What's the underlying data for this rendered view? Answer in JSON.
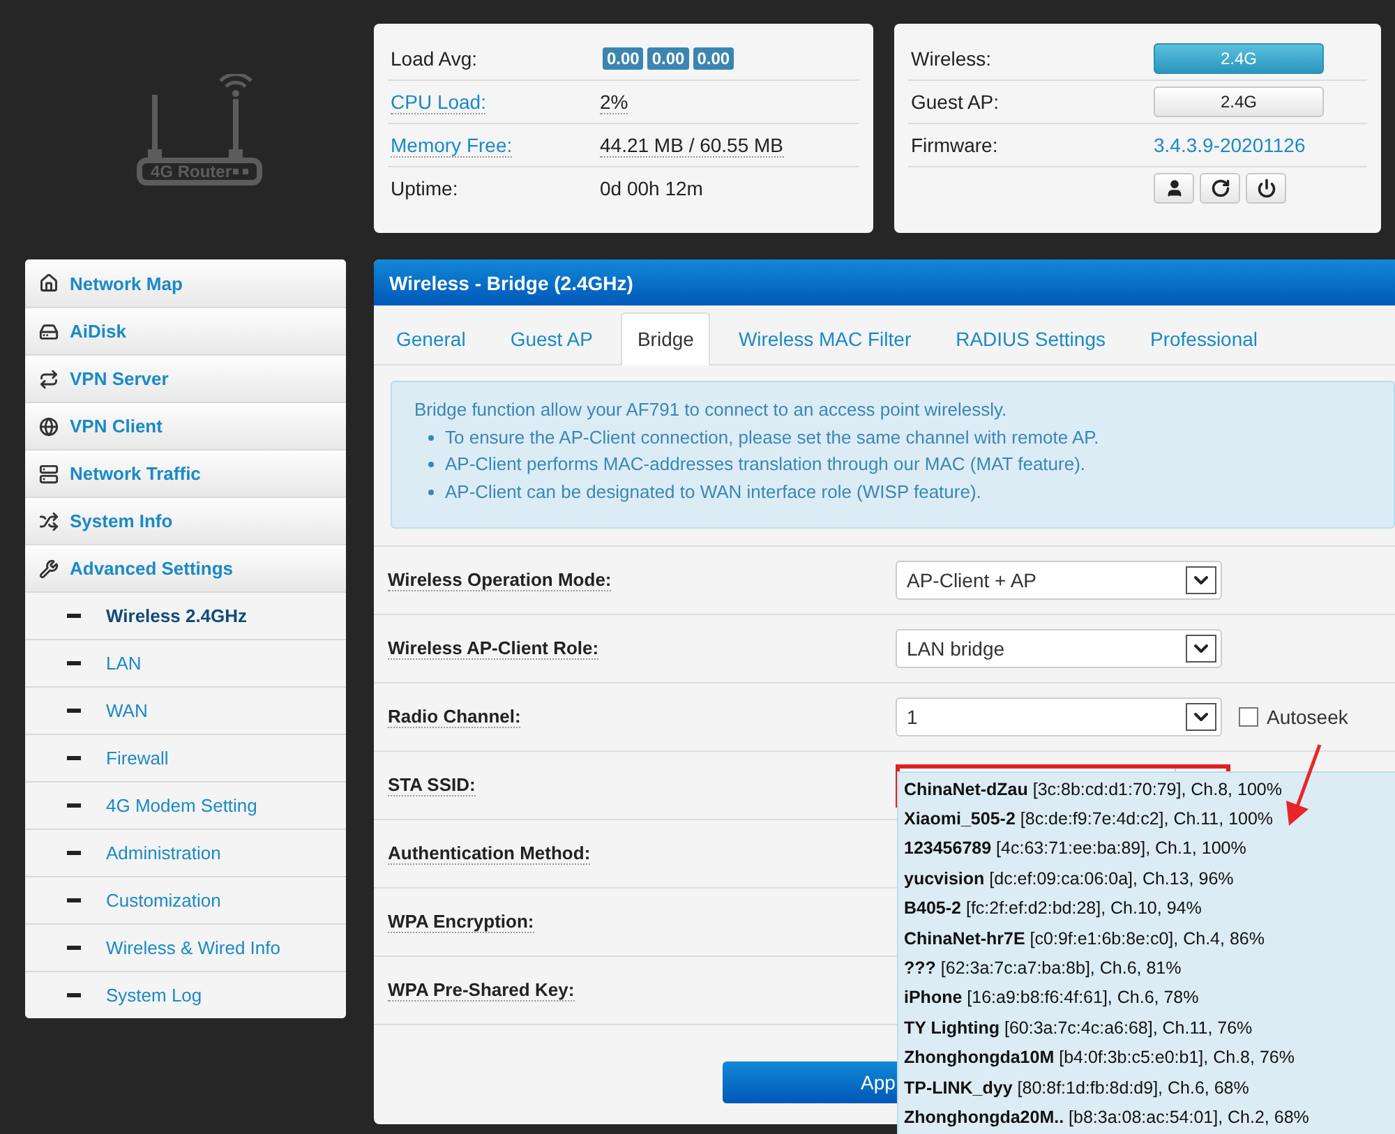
{
  "logo": {
    "text": "4G Router"
  },
  "status": {
    "load_avg": {
      "label": "Load Avg:",
      "values": [
        "0.00",
        "0.00",
        "0.00"
      ]
    },
    "rows": [
      {
        "label": "CPU Load:",
        "value": "2%",
        "kind": "link"
      },
      {
        "label": "Memory Free:",
        "value": "44.21 MB / 60.55 MB",
        "kind": "link"
      },
      {
        "label": "Uptime:",
        "value": "0d 00h 12m",
        "kind": "plain"
      }
    ]
  },
  "radio": {
    "rows": [
      {
        "label": "Wireless:",
        "button": "2.4G",
        "on": true
      },
      {
        "label": "Guest AP:",
        "button": "2.4G",
        "on": false
      }
    ],
    "firmware": {
      "label": "Firmware:",
      "value": "3.4.3.9-20201126"
    }
  },
  "sidebar": {
    "items": [
      {
        "label": "Network Map",
        "kind": "main",
        "selected": false
      },
      {
        "label": "AiDisk",
        "kind": "main",
        "selected": false
      },
      {
        "label": "VPN Server",
        "kind": "main",
        "selected": false
      },
      {
        "label": "VPN Client",
        "kind": "main",
        "selected": false
      },
      {
        "label": "Network Traffic",
        "kind": "main",
        "selected": false
      },
      {
        "label": "System Info",
        "kind": "main",
        "selected": false
      },
      {
        "label": "Advanced Settings",
        "kind": "main",
        "selected": false
      },
      {
        "label": "Wireless 2.4GHz",
        "kind": "sub",
        "selected": true
      },
      {
        "label": "LAN",
        "kind": "sub",
        "selected": false
      },
      {
        "label": "WAN",
        "kind": "sub",
        "selected": false
      },
      {
        "label": "Firewall",
        "kind": "sub",
        "selected": false
      },
      {
        "label": "4G Modem Setting",
        "kind": "sub",
        "selected": false
      },
      {
        "label": "Administration",
        "kind": "sub",
        "selected": false
      },
      {
        "label": "Customization",
        "kind": "sub",
        "selected": false
      },
      {
        "label": "Wireless & Wired Info",
        "kind": "sub",
        "selected": false
      },
      {
        "label": "System Log",
        "kind": "sub",
        "selected": false
      }
    ]
  },
  "panel": {
    "title": "Wireless - Bridge (2.4GHz)",
    "tabs": [
      {
        "label": "General",
        "selected": false
      },
      {
        "label": "Guest AP",
        "selected": false
      },
      {
        "label": "Bridge",
        "selected": true
      },
      {
        "label": "Wireless MAC Filter",
        "selected": false
      },
      {
        "label": "RADIUS Settings",
        "selected": false
      },
      {
        "label": "Professional",
        "selected": false
      }
    ],
    "info": {
      "intro": "Bridge function allow your AF791 to connect to an access point wirelessly.",
      "bullets": [
        "To ensure the AP-Client connection, please set the same channel with remote AP.",
        "AP-Client performs MAC-addresses translation through our MAC (MAT feature).",
        "AP-Client can be designated to WAN interface role (WISP feature)."
      ]
    },
    "fields": [
      {
        "label": "Wireless Operation Mode:",
        "kind": "select",
        "value": "AP-Client + AP"
      },
      {
        "label": "Wireless AP-Client Role:",
        "kind": "select",
        "value": "LAN bridge"
      },
      {
        "label": "Radio Channel:",
        "kind": "select",
        "value": "1",
        "checkbox": {
          "label": "Autoseek",
          "checked": false
        }
      },
      {
        "label": "STA SSID:",
        "kind": "combo",
        "highlighted": true
      },
      {
        "label": "Authentication Method:",
        "kind": "hidden"
      },
      {
        "label": "WPA Encryption:",
        "kind": "hidden"
      },
      {
        "label": "WPA Pre-Shared Key:",
        "kind": "hidden"
      }
    ],
    "apply": "App",
    "ssid_list": [
      "**ChinaNet-dZau** [3c:8b:cd:d1:70:79], Ch.8, 100%",
      "**Xiaomi_505-2** [8c:de:f9:7e:4d:c2], Ch.11, 100%",
      "**123456789** [4c:63:71:ee:ba:89], Ch.1, 100%",
      "**yucvision** [dc:ef:09:ca:06:0a], Ch.13, 96%",
      "**B405-2** [fc:2f:ef:d2:bd:28], Ch.10, 94%",
      "**ChinaNet-hr7E** [c0:9f:e1:6b:8e:c0], Ch.4, 86%",
      "**???** [62:3a:7c:a7:ba:8b], Ch.6, 81%",
      "**iPhone** [16:a9:b8:f6:4f:61], Ch.6, 78%",
      "**TY Lighting** [60:3a:7c:4c:a6:68], Ch.11, 76%",
      "**Zhonghongda10M** [b4:0f:3b:c5:e0:b1], Ch.8, 76%",
      "**TP-LINK_dyy** [80:8f:1d:fb:8d:d9], Ch.6, 68%",
      "**Zhonghongda20M..** [b8:3a:08:ac:54:01], Ch.2, 68%"
    ]
  }
}
